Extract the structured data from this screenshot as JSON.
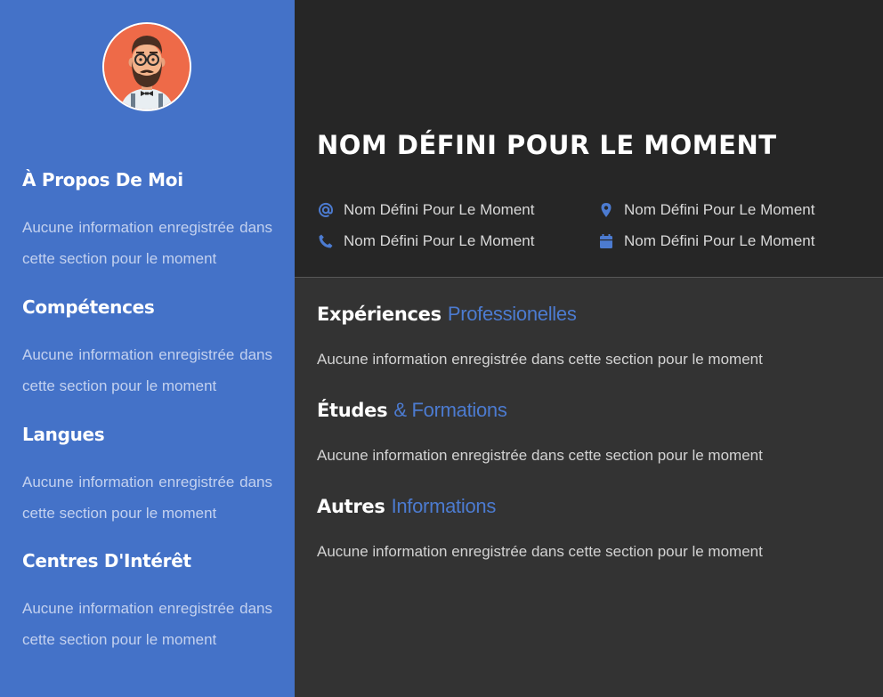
{
  "colors": {
    "sidebar": "#4472c8",
    "header": "#262626",
    "main": "#333333",
    "accent": "#4c7bd0",
    "avatar_bg": "#ee6a48"
  },
  "sidebar": {
    "avatar_icon": "hipster-avatar-icon",
    "sections": [
      {
        "title": "À Propos De Moi",
        "text": "Aucune information enregistrée dans cette section pour le moment"
      },
      {
        "title": "Compétences",
        "text": "Aucune information enregistrée dans cette section pour le moment"
      },
      {
        "title": "Langues",
        "text": "Aucune information enregistrée dans cette section pour le moment"
      },
      {
        "title": "Centres D'Intérêt",
        "text": "Aucune information enregistrée dans cette section pour le moment"
      }
    ]
  },
  "header": {
    "name": "NOM DÉFINI POUR LE MOMENT",
    "contacts": [
      {
        "icon": "at-sign-icon",
        "text": "Nom Défini Pour Le Moment"
      },
      {
        "icon": "phone-icon",
        "text": "Nom Défini Pour Le Moment"
      },
      {
        "icon": "map-marker-icon",
        "text": "Nom Défini Pour Le Moment"
      },
      {
        "icon": "calendar-icon",
        "text": "Nom Défini Pour Le Moment"
      }
    ]
  },
  "main": {
    "sections": [
      {
        "title": "Expériences",
        "accent": "Professionelles",
        "text": "Aucune information enregistrée dans cette section pour le moment"
      },
      {
        "title": "Études",
        "accent": "& Formations",
        "text": "Aucune information enregistrée dans cette section pour le moment"
      },
      {
        "title": "Autres",
        "accent": "Informations",
        "text": "Aucune information enregistrée dans cette section pour le moment"
      }
    ]
  }
}
